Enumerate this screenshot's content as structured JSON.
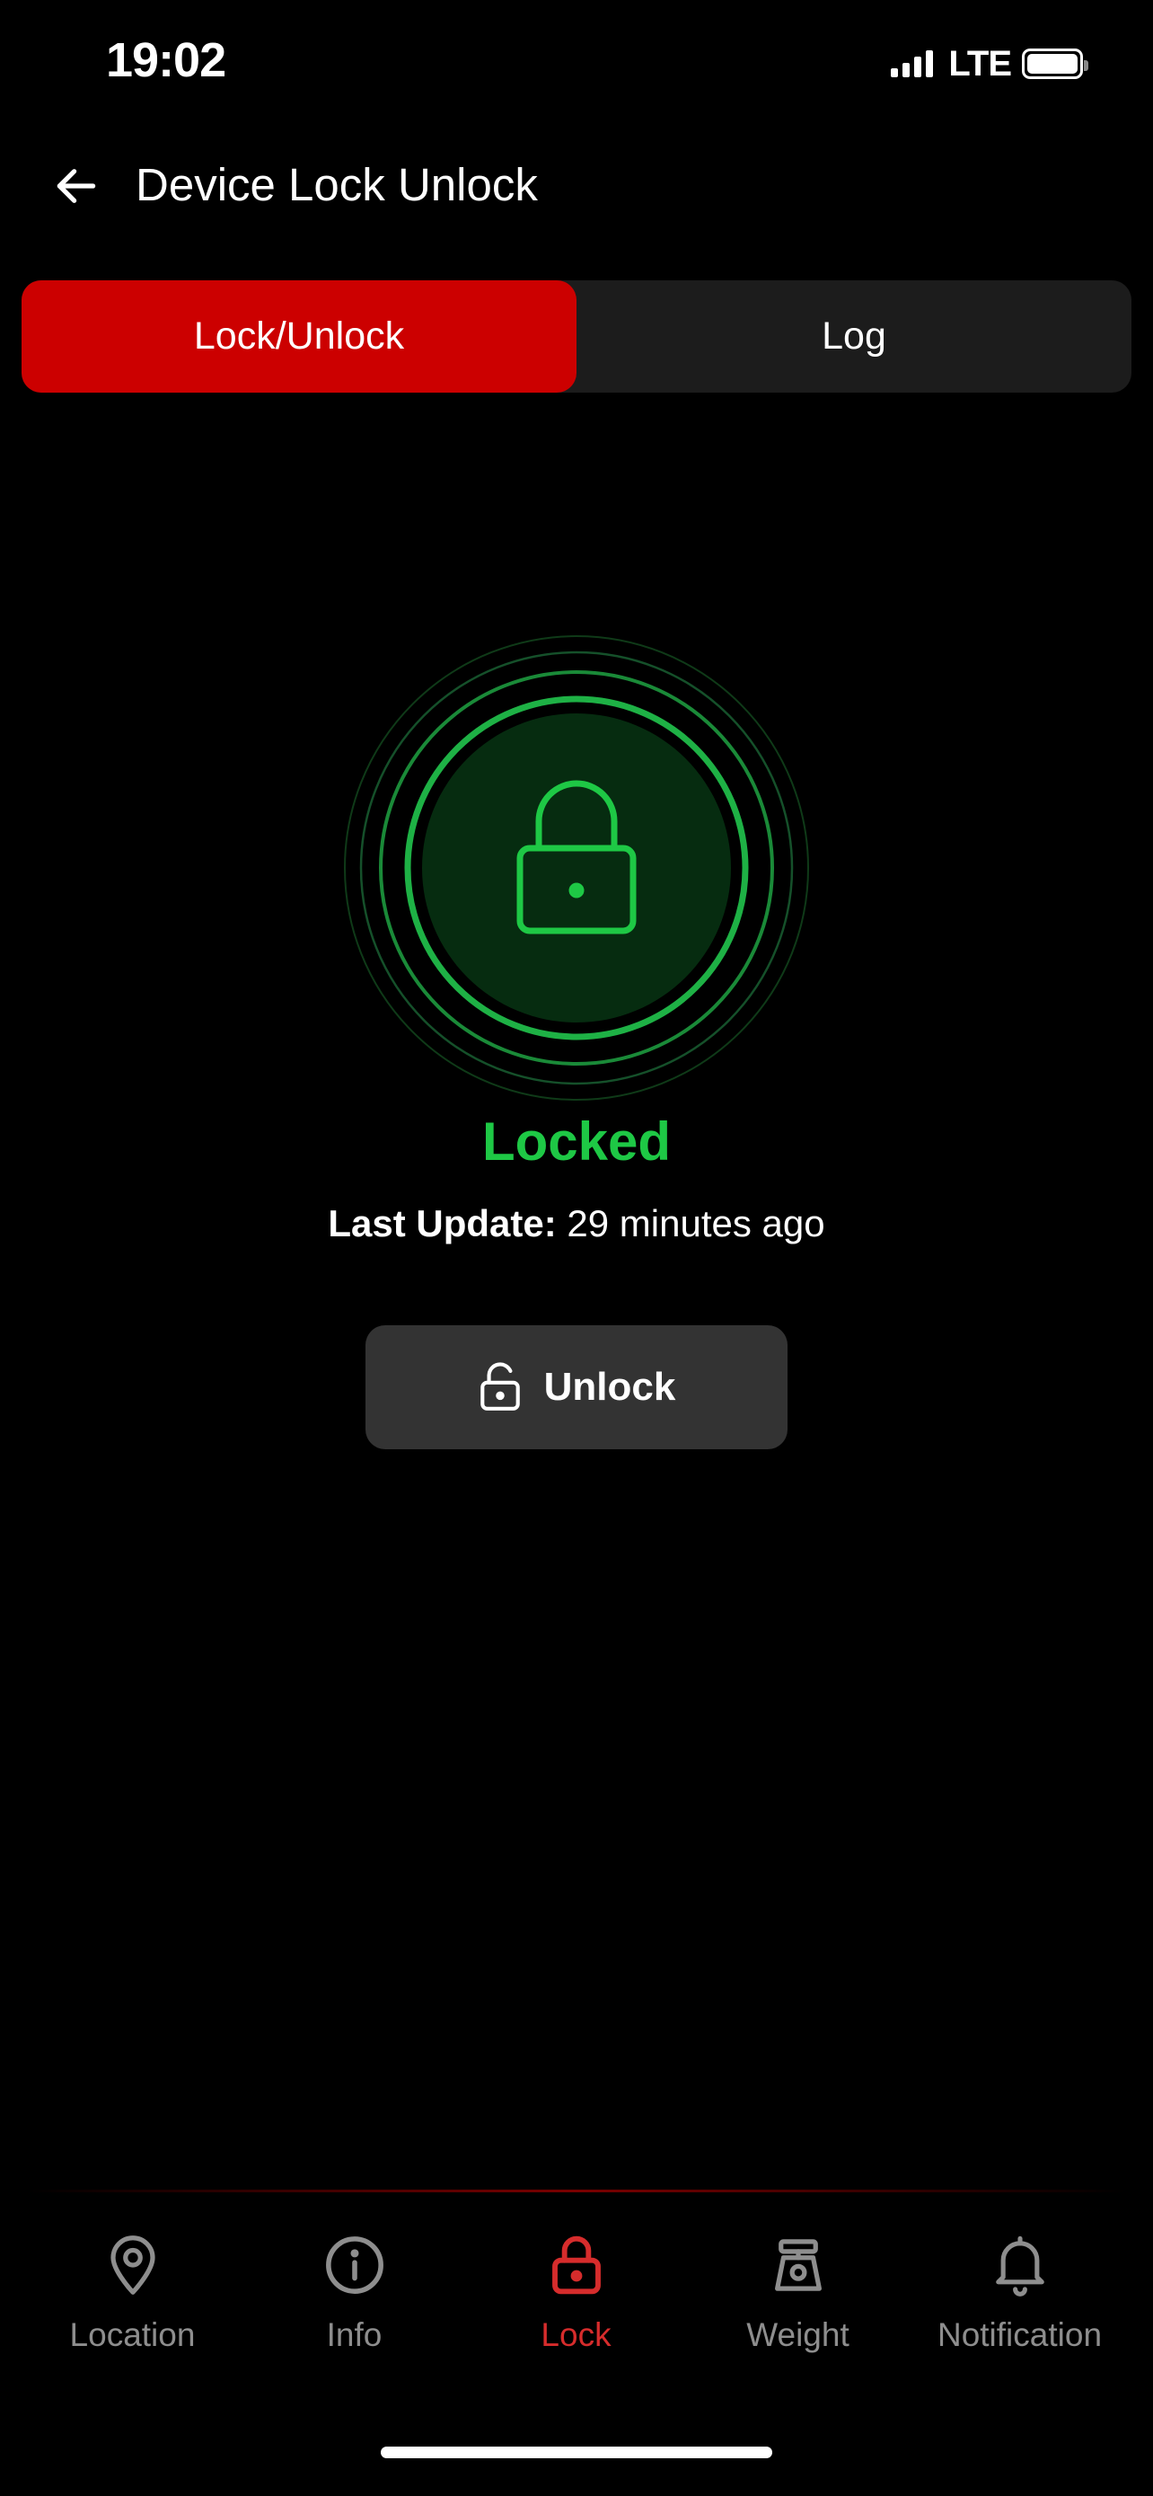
{
  "status_bar": {
    "time": "19:02",
    "network": "LTE"
  },
  "header": {
    "title": "Device Lock Unlock"
  },
  "tabs": [
    {
      "label": "Lock/Unlock",
      "active": true
    },
    {
      "label": "Log",
      "active": false
    }
  ],
  "lock_state": {
    "status": "Locked",
    "last_update_label": "Last Update:",
    "last_update_value": "29 minutes ago",
    "status_color": "#1ec845"
  },
  "actions": {
    "unlock_label": "Unlock"
  },
  "bottom_nav": {
    "items": [
      {
        "label": "Location",
        "icon": "location-pin-icon",
        "active": false
      },
      {
        "label": "Info",
        "icon": "info-icon",
        "active": false
      },
      {
        "label": "Lock",
        "icon": "lock-icon",
        "active": true
      },
      {
        "label": "Weight",
        "icon": "scale-icon",
        "active": false
      },
      {
        "label": "Notification",
        "icon": "bell-icon",
        "active": false
      }
    ]
  },
  "colors": {
    "accent": "#cc0000",
    "locked_green": "#1ec845",
    "nav_active": "#d62c2c",
    "nav_inactive": "#8e8e8e"
  }
}
